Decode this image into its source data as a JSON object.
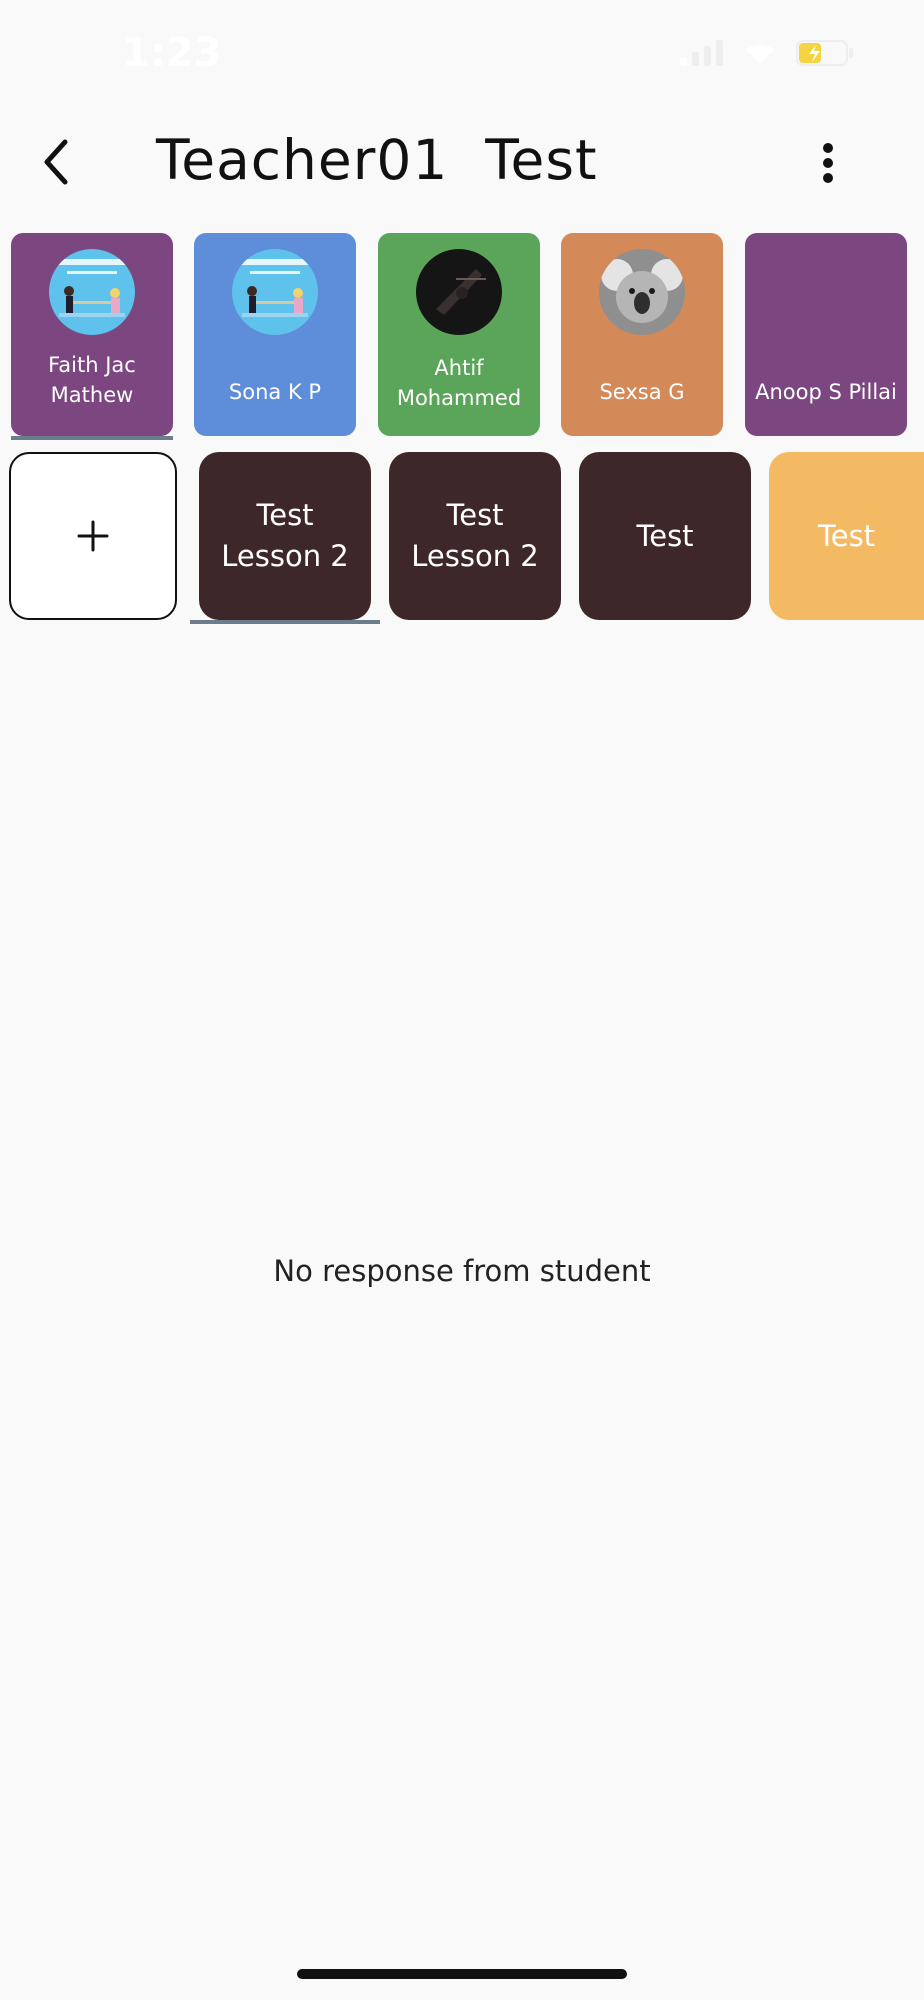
{
  "status_bar": {
    "time": "1:23",
    "battery_color": "#f5d442"
  },
  "header": {
    "title": "Teacher01  Test",
    "back_icon": "chevron-left-icon",
    "menu_icon": "more-vertical-icon"
  },
  "students": [
    {
      "name": "Faith  Jac\nMathew",
      "color": "#7c4680",
      "avatar": "tug-of-war-cartoon",
      "selected": true
    },
    {
      "name": "Sona K P",
      "color": "#5e8ed9",
      "avatar": "tug-of-war-cartoon",
      "selected": false
    },
    {
      "name": "Ahtif\nMohammed",
      "color": "#5aa559",
      "avatar": "dark-photo",
      "selected": false
    },
    {
      "name": "Sexsa  G",
      "color": "#d48958",
      "avatar": "koala-photo",
      "selected": false
    },
    {
      "name": "Anoop S Pillai",
      "color": "#7c4680",
      "avatar": "",
      "selected": false
    }
  ],
  "lessons": {
    "add_label": "+",
    "items": [
      {
        "label": "Test\nLesson 2",
        "color": "#3e2729",
        "selected": true
      },
      {
        "label": "Test\nLesson 2",
        "color": "#3e2729",
        "selected": false
      },
      {
        "label": "Test",
        "color": "#3e2729",
        "selected": false
      },
      {
        "label": "Test",
        "color": "#f3b963",
        "selected": false
      }
    ]
  },
  "main": {
    "empty_message": "No response from student"
  },
  "colors": {
    "background": "#f9f9f9",
    "underline": "#6b7d8c"
  }
}
